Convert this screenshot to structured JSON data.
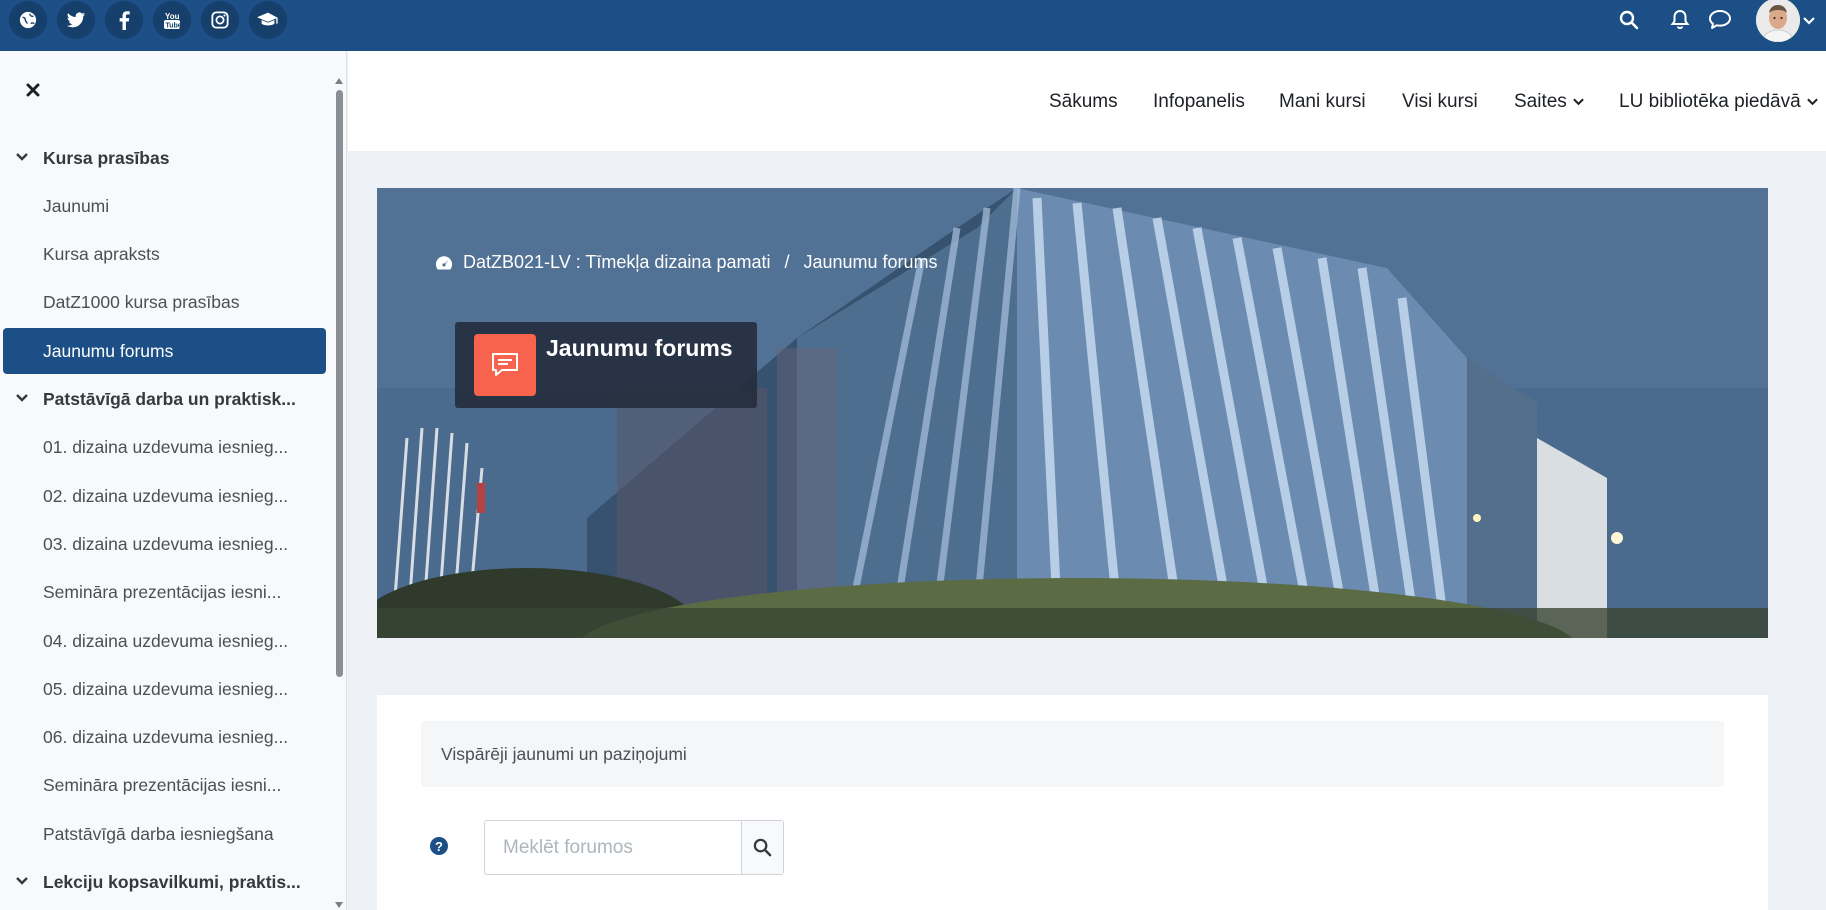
{
  "topbar": {
    "social_icons": [
      "globe-icon",
      "twitter-icon",
      "facebook-icon",
      "youtube-icon",
      "instagram-icon",
      "graduation-cap-icon"
    ],
    "right_icons": [
      "search-icon",
      "bell-icon",
      "chat-icon"
    ]
  },
  "drawer": {
    "items": [
      {
        "label": "Kursa prasības",
        "type": "section"
      },
      {
        "label": "Jaunumi",
        "type": "item"
      },
      {
        "label": "Kursa apraksts",
        "type": "item"
      },
      {
        "label": "DatZ1000 kursa prasības",
        "type": "item"
      },
      {
        "label": "Jaunumu forums",
        "type": "item",
        "active": true
      },
      {
        "label": "Patstāvīgā darba un praktisk...",
        "type": "section"
      },
      {
        "label": "01. dizaina uzdevuma iesnieg...",
        "type": "item"
      },
      {
        "label": "02. dizaina uzdevuma iesnieg...",
        "type": "item"
      },
      {
        "label": "03. dizaina uzdevuma iesnieg...",
        "type": "item"
      },
      {
        "label": "Semināra prezentācijas iesni...",
        "type": "item"
      },
      {
        "label": "04. dizaina uzdevuma iesnieg...",
        "type": "item"
      },
      {
        "label": "05. dizaina uzdevuma iesnieg...",
        "type": "item"
      },
      {
        "label": "06. dizaina uzdevuma iesnieg...",
        "type": "item"
      },
      {
        "label": "Semināra prezentācijas iesni...",
        "type": "item"
      },
      {
        "label": "Patstāvīgā darba iesniegšana",
        "type": "item"
      },
      {
        "label": "Lekciju kopsavilkumi, praktis...",
        "type": "section"
      }
    ]
  },
  "navbar": {
    "links": [
      {
        "label": "Sākums",
        "dropdown": false
      },
      {
        "label": "Infopanelis",
        "dropdown": false
      },
      {
        "label": "Mani kursi",
        "dropdown": false
      },
      {
        "label": "Visi kursi",
        "dropdown": false
      },
      {
        "label": "Saites",
        "dropdown": true
      },
      {
        "label": "LU bibliotēka piedāvā",
        "dropdown": true
      }
    ]
  },
  "hero": {
    "breadcrumb": {
      "course": "DatZB021-LV : Tīmekļa dizaina pamati",
      "separator": "/",
      "current": "Jaunumu forums"
    },
    "title": "Jaunumu forums",
    "title_icon": "forum-icon"
  },
  "content": {
    "intro": "Vispārēji jaunumi un paziņojumi",
    "search_placeholder": "Meklēt forumos"
  },
  "colors": {
    "brand": "#1c4f86",
    "forum_icon_bg": "#f7634d"
  }
}
